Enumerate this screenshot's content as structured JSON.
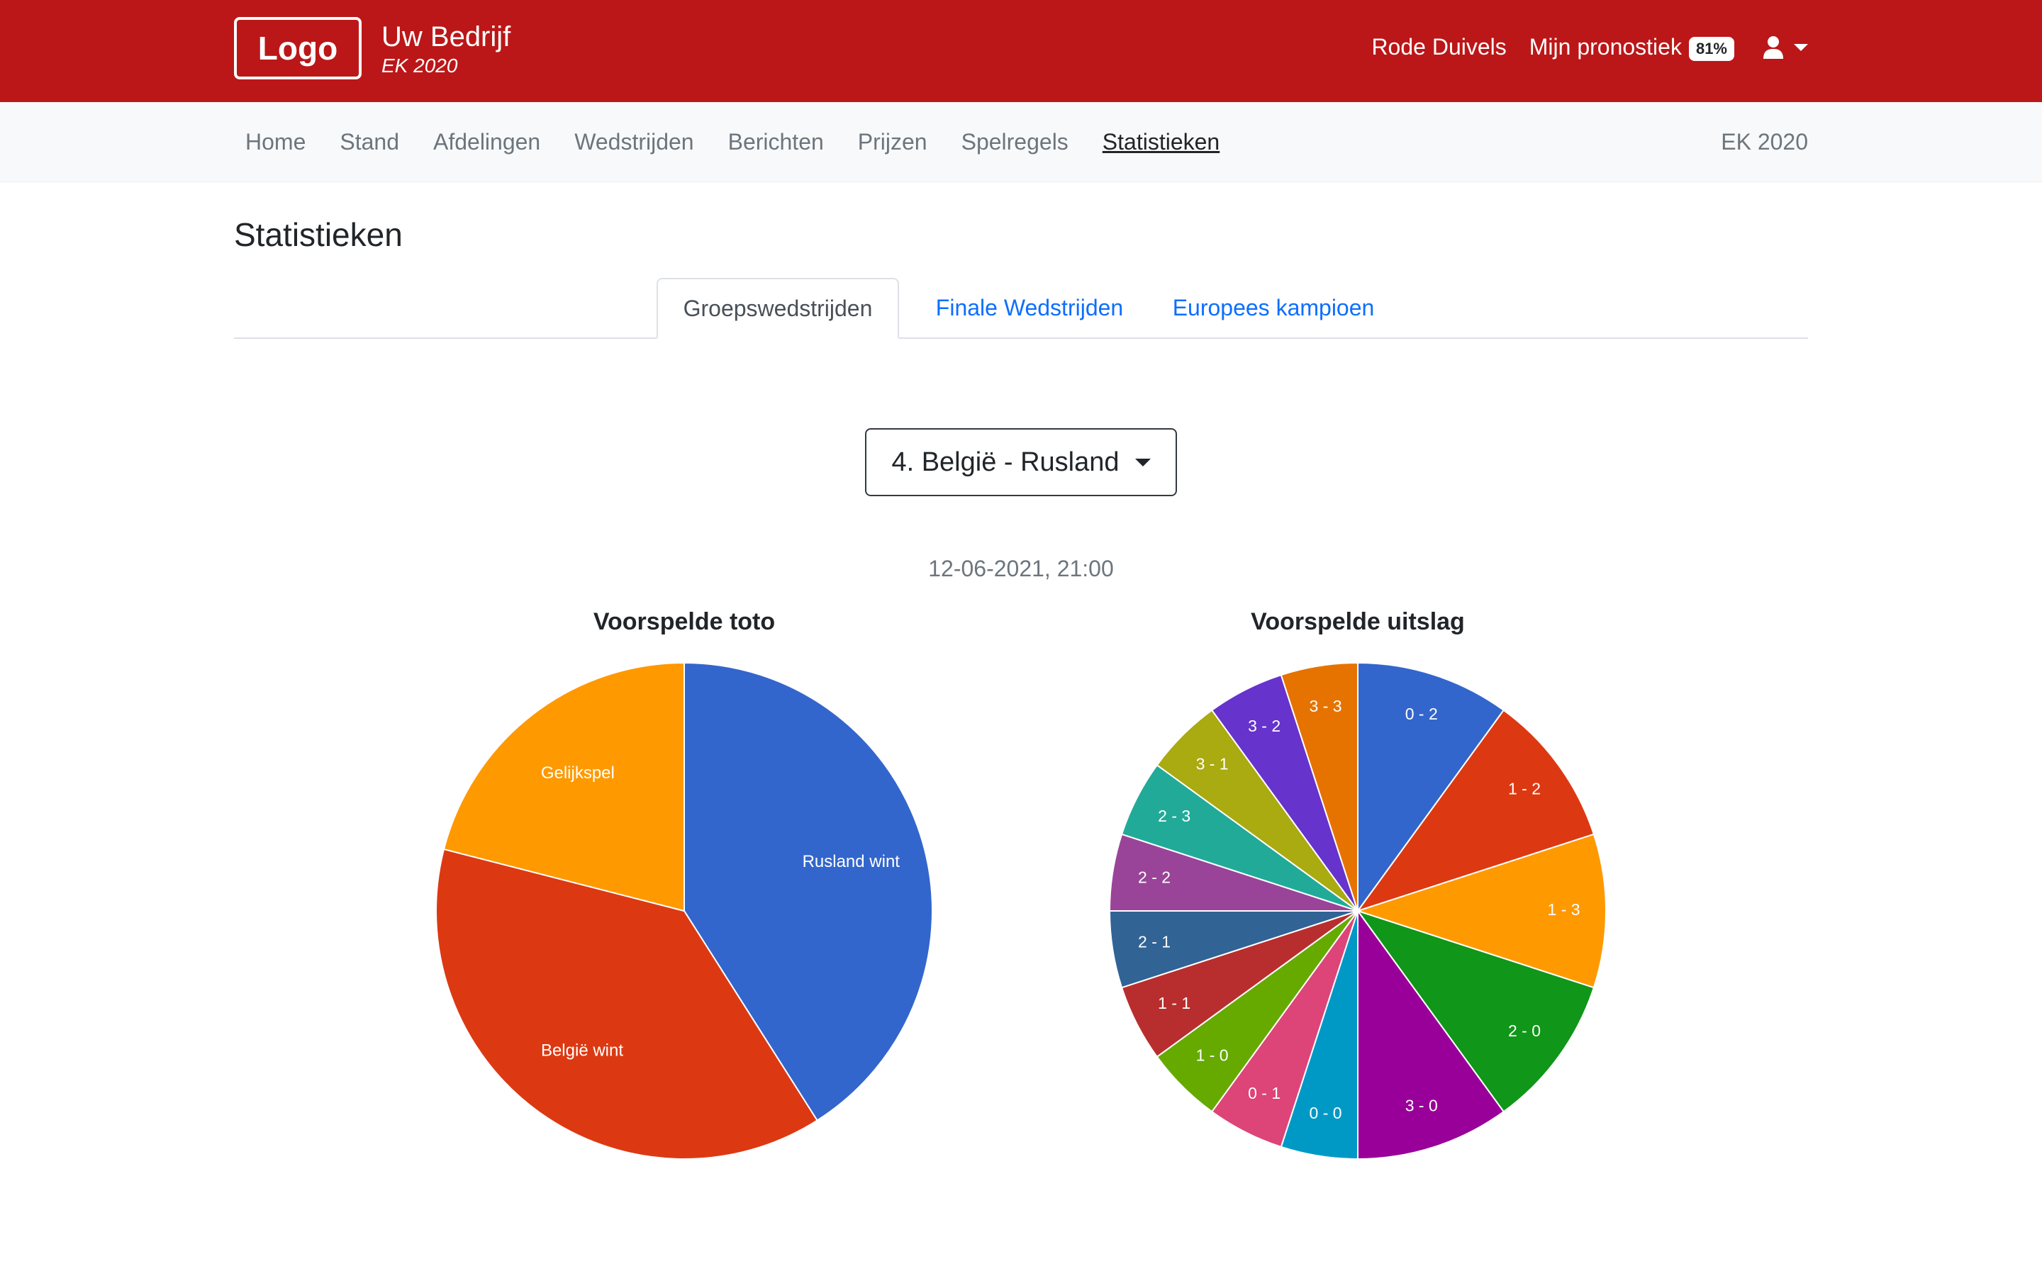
{
  "header": {
    "logo_text": "Logo",
    "company": "Uw Bedrijf",
    "tournament": "EK 2020",
    "links": [
      "Rode Duivels",
      "Mijn pronostiek"
    ],
    "pronostiek_badge": "81%",
    "user_icon": "user-icon"
  },
  "nav": {
    "items": [
      "Home",
      "Stand",
      "Afdelingen",
      "Wedstrijden",
      "Berichten",
      "Prijzen",
      "Spelregels",
      "Statistieken"
    ],
    "active": "Statistieken",
    "right_label": "EK 2020"
  },
  "page": {
    "title": "Statistieken",
    "tabs": [
      "Groepswedstrijden",
      "Finale Wedstrijden",
      "Europees kampioen"
    ],
    "active_tab": "Groepswedstrijden",
    "match_select": "4. België - Rusland",
    "match_date": "12-06-2021, 21:00"
  },
  "chart_data": [
    {
      "type": "pie",
      "title": "Voorspelde toto",
      "slices": [
        {
          "label": "Rusland wint",
          "value": 41,
          "color": "#3366cc"
        },
        {
          "label": "België wint",
          "value": 38,
          "color": "#dc3912"
        },
        {
          "label": "Gelijkspel",
          "value": 21,
          "color": "#ff9900"
        }
      ]
    },
    {
      "type": "pie",
      "title": "Voorspelde uitslag",
      "slices": [
        {
          "label": "0 - 2",
          "value": 10,
          "color": "#3366cc"
        },
        {
          "label": "1 - 2",
          "value": 10,
          "color": "#dc3912"
        },
        {
          "label": "1 - 3",
          "value": 10,
          "color": "#ff9900"
        },
        {
          "label": "2 - 0",
          "value": 10,
          "color": "#109618"
        },
        {
          "label": "3 - 0",
          "value": 10,
          "color": "#990099"
        },
        {
          "label": "0 - 0",
          "value": 5,
          "color": "#0099c6"
        },
        {
          "label": "0 - 1",
          "value": 5,
          "color": "#dd4477"
        },
        {
          "label": "1 - 0",
          "value": 5,
          "color": "#66aa00"
        },
        {
          "label": "1 - 1",
          "value": 5,
          "color": "#b82e2e"
        },
        {
          "label": "2 - 1",
          "value": 5,
          "color": "#316395"
        },
        {
          "label": "2 - 2",
          "value": 5,
          "color": "#994499"
        },
        {
          "label": "2 - 3",
          "value": 5,
          "color": "#22aa99"
        },
        {
          "label": "3 - 1",
          "value": 5,
          "color": "#aaaa11"
        },
        {
          "label": "3 - 2",
          "value": 5,
          "color": "#6633cc"
        },
        {
          "label": "3 - 3",
          "value": 5,
          "color": "#e67300"
        }
      ]
    }
  ]
}
